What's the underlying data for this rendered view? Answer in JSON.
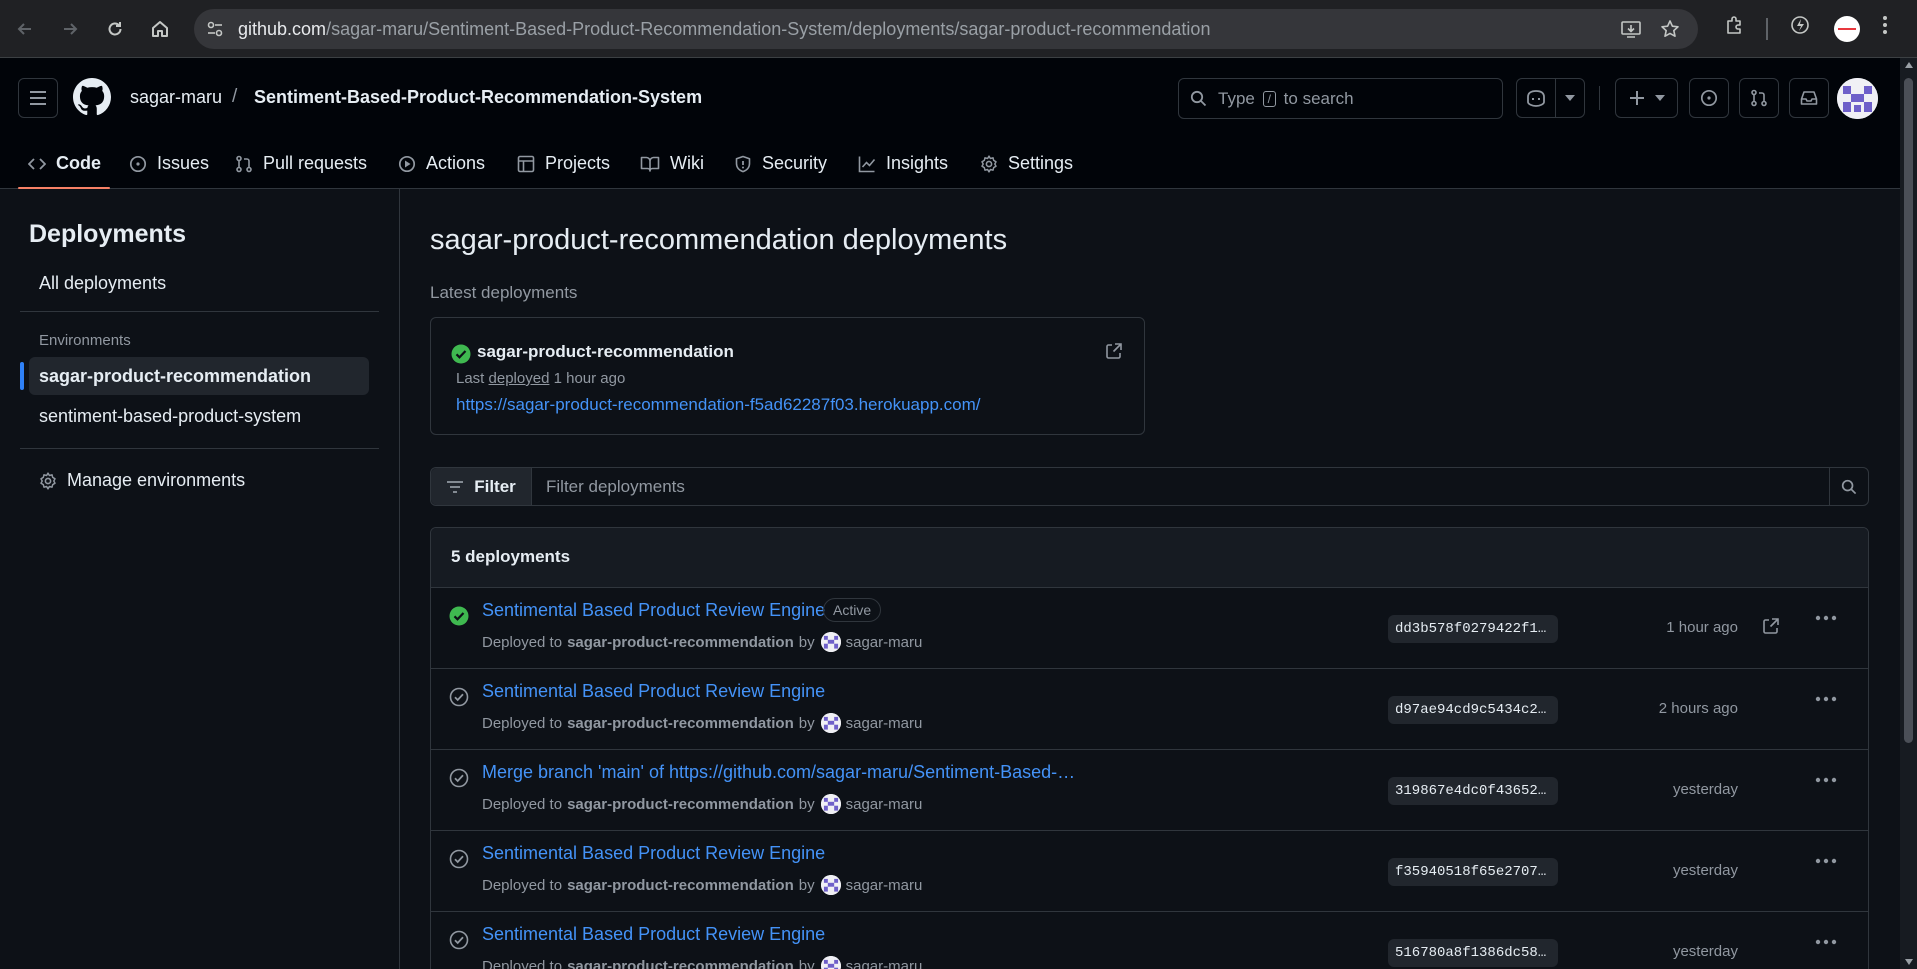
{
  "browser": {
    "url_host": "github.com",
    "url_path": "/sagar-maru/Sentiment-Based-Product-Recommendation-System/deployments/sagar-product-recommendation"
  },
  "header": {
    "owner": "sagar-maru",
    "separator": "/",
    "repo": "Sentiment-Based-Product-Recommendation-System",
    "search_before": "Type",
    "search_key": "/",
    "search_after": "to search"
  },
  "tabs": [
    {
      "label": "Code",
      "icon": "code-icon",
      "selected": true
    },
    {
      "label": "Issues",
      "icon": "issue-icon"
    },
    {
      "label": "Pull requests",
      "icon": "pull-request-icon"
    },
    {
      "label": "Actions",
      "icon": "play-icon"
    },
    {
      "label": "Projects",
      "icon": "table-icon"
    },
    {
      "label": "Wiki",
      "icon": "book-icon"
    },
    {
      "label": "Security",
      "icon": "shield-icon"
    },
    {
      "label": "Insights",
      "icon": "graph-icon"
    },
    {
      "label": "Settings",
      "icon": "gear-icon"
    }
  ],
  "sidebar": {
    "title": "Deployments",
    "all_deployments": "All deployments",
    "environments_label": "Environments",
    "environments": [
      {
        "label": "sagar-product-recommendation",
        "active": true
      },
      {
        "label": "sentiment-based-product-system",
        "active": false
      }
    ],
    "manage": "Manage environments"
  },
  "main": {
    "title": "sagar-product-recommendation deployments",
    "latest_label": "Latest deployments",
    "latest": {
      "name": "sagar-product-recommendation",
      "meta_prefix": "Last",
      "meta_link": "deployed",
      "meta_time": "1 hour ago",
      "url": "https://sagar-product-recommendation-f5ad62287f03.herokuapp.com/"
    },
    "filter": {
      "button": "Filter",
      "placeholder": "Filter deployments"
    },
    "count_label": "5 deployments",
    "deployed_to": "Deployed to",
    "by": "by",
    "deployments": [
      {
        "title": "Sentimental Based Product Review Engine",
        "badge": "Active",
        "env": "sagar-product-recommendation",
        "user": "sagar-maru",
        "sha": "dd3b578f0279422f1…",
        "time": "1 hour ago",
        "status": "success"
      },
      {
        "title": "Sentimental Based Product Review Engine",
        "badge": "",
        "env": "sagar-product-recommendation",
        "user": "sagar-maru",
        "sha": "d97ae94cd9c5434c2…",
        "time": "2 hours ago",
        "status": "inactive"
      },
      {
        "title": "Merge branch 'main' of https://github.com/sagar-maru/Sentiment-Based-…",
        "badge": "",
        "env": "sagar-product-recommendation",
        "user": "sagar-maru",
        "sha": "319867e4dc0f43652…",
        "time": "yesterday",
        "status": "inactive"
      },
      {
        "title": "Sentimental Based Product Review Engine",
        "badge": "",
        "env": "sagar-product-recommendation",
        "user": "sagar-maru",
        "sha": "f35940518f65e2707…",
        "time": "yesterday",
        "status": "inactive"
      },
      {
        "title": "Sentimental Based Product Review Engine",
        "badge": "",
        "env": "sagar-product-recommendation",
        "user": "sagar-maru",
        "sha": "516780a8f1386dc58…",
        "time": "yesterday",
        "status": "inactive"
      }
    ]
  },
  "colors": {
    "accent_link": "#4493f8",
    "success": "#3fb950",
    "tab_underline": "#f78166",
    "sidebar_marker": "#2f81f7"
  }
}
